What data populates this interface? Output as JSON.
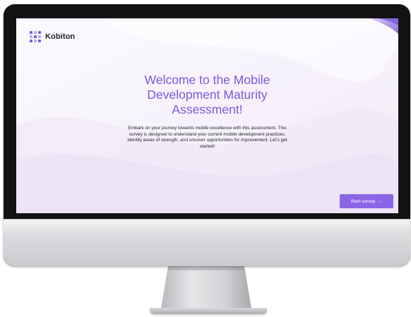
{
  "brand": {
    "name": "Kobiton",
    "accent_color": "#7a58dc",
    "logo_icon": "kobiton-logo-icon"
  },
  "welcome": {
    "title": "Welcome to the Mobile Development Maturity Assessment!",
    "description": "Embark on your journey towards mobile excellence with this assessment. This survey is designed to understand your current mobile development practices, identify areas of strength, and uncover opportunities for improvement. Let's get started!"
  },
  "actions": {
    "start_label": "Start survey",
    "start_icon": "arrow-right-icon",
    "start_arrow": "→",
    "button_color": "#8a66e6"
  }
}
